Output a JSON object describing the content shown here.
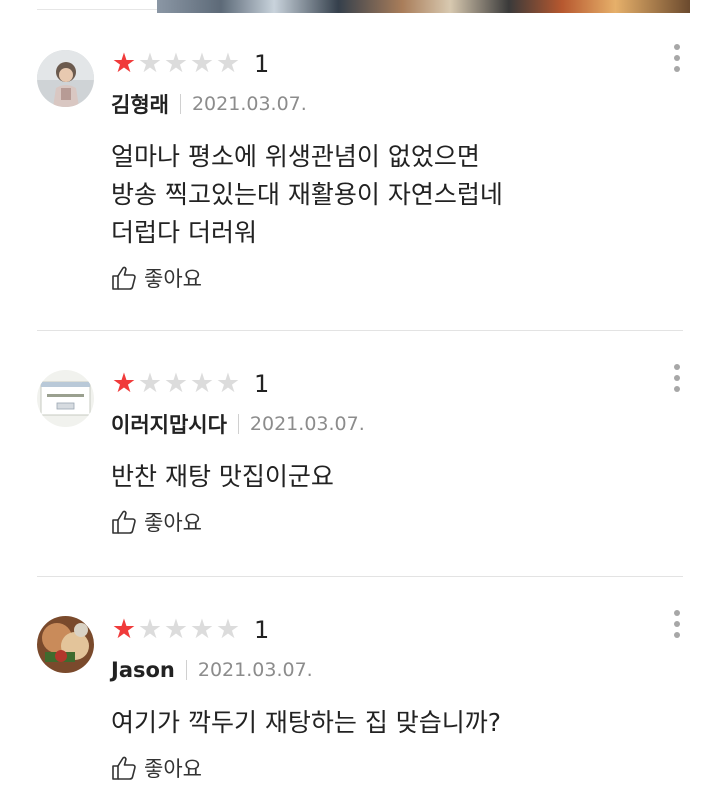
{
  "reviews": [
    {
      "avatar_icon": "child-photo-avatar",
      "stars_filled": 1,
      "stars_total": 5,
      "rating": "1",
      "author": "김형래",
      "date": "2021.03.07.",
      "text": "얼마나 평소에 위생관념이 없었으면\n방송 찍고있는대 재활용이 자연스럽네\n더럽다 더러워",
      "like_label": "좋아요"
    },
    {
      "avatar_icon": "screenshot-avatar",
      "stars_filled": 1,
      "stars_total": 5,
      "rating": "1",
      "author": "이러지맙시다",
      "date": "2021.03.07.",
      "text": "반찬 재탕 맛집이군요",
      "like_label": "좋아요"
    },
    {
      "avatar_icon": "food-photo-avatar",
      "stars_filled": 1,
      "stars_total": 5,
      "rating": "1",
      "author": "Jason",
      "date": "2021.03.07.",
      "text": "여기가 깍두기 재탕하는 집 맞습니까?",
      "like_label": "좋아요"
    }
  ],
  "colors": {
    "star_on": "#f03b3b",
    "star_off": "#dcdcdc",
    "date": "#8c8c8c",
    "divider": "#e3e3e3"
  }
}
